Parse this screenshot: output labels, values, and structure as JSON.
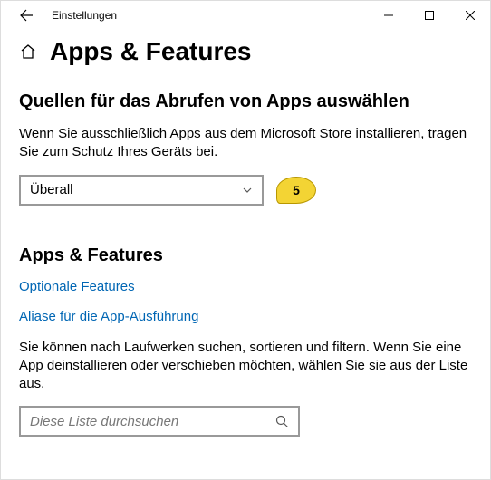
{
  "window": {
    "title": "Einstellungen"
  },
  "page": {
    "title": "Apps & Features"
  },
  "source_section": {
    "heading": "Quellen für das Abrufen von Apps auswählen",
    "description": "Wenn Sie ausschließlich Apps aus dem Microsoft Store installieren, tragen Sie zum Schutz Ihres Geräts bei.",
    "dropdown_value": "Überall"
  },
  "callout": {
    "number": "5"
  },
  "apps_section": {
    "heading": "Apps & Features",
    "link_optional": "Optionale Features",
    "link_aliases": "Aliase für die App-Ausführung",
    "description": "Sie können nach Laufwerken suchen, sortieren und filtern. Wenn Sie eine App deinstallieren oder verschieben möchten, wählen Sie sie aus der Liste aus.",
    "search_placeholder": "Diese Liste durchsuchen"
  }
}
